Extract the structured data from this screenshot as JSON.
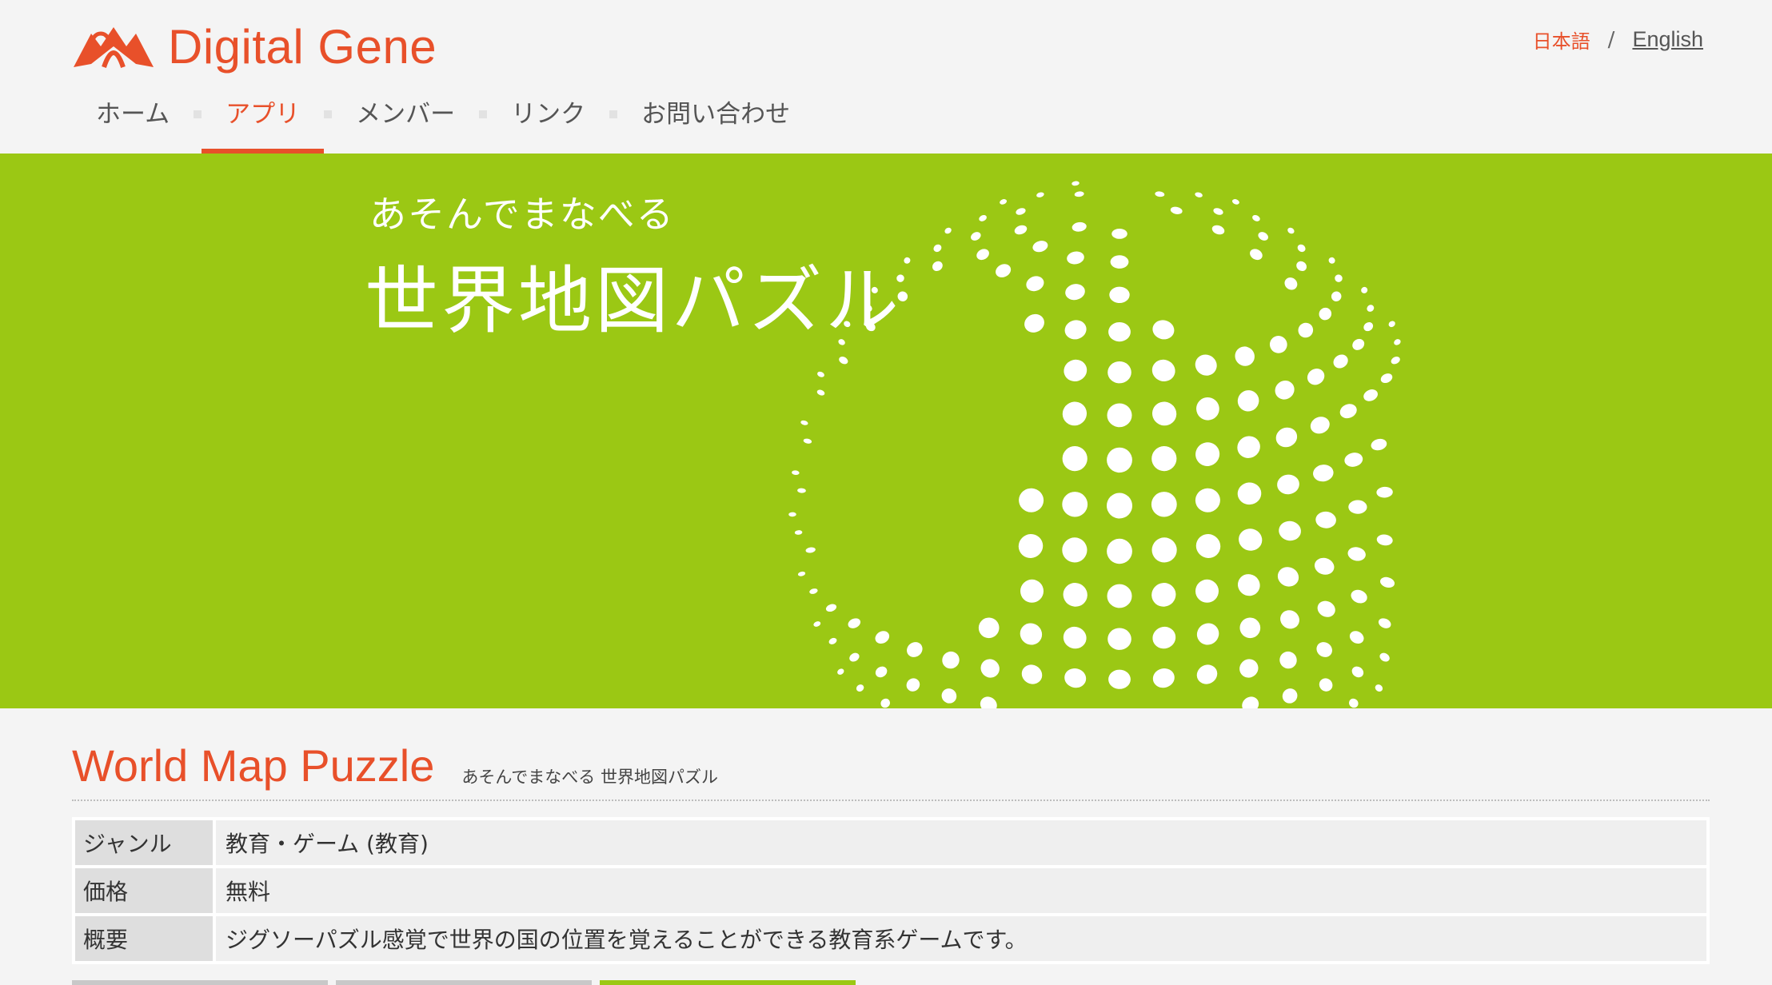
{
  "header": {
    "logo_text": "Digital Gene",
    "lang_jp": "日本語",
    "lang_sep": "/",
    "lang_en": "English"
  },
  "nav": [
    {
      "label": "ホーム",
      "active": false
    },
    {
      "label": "アプリ",
      "active": true
    },
    {
      "label": "メンバー",
      "active": false
    },
    {
      "label": "リンク",
      "active": false
    },
    {
      "label": "お問い合わせ",
      "active": false
    }
  ],
  "banner": {
    "subtitle": "あそんでまなべる",
    "title": "世界地図パズル",
    "background": "#9bc814"
  },
  "app": {
    "title": "World Map Puzzle",
    "subtitle": "あそんでまなべる 世界地図パズル"
  },
  "details": [
    {
      "label": "ジャンル",
      "value": "教育・ゲーム (教育)"
    },
    {
      "label": "価格",
      "value": "無料"
    },
    {
      "label": "概要",
      "value": "ジグソーパズル感覚で世界の国の位置を覚えることができる教育系ゲームです。"
    }
  ],
  "colors": {
    "accent": "#e8502a",
    "banner_green": "#9bc814"
  }
}
